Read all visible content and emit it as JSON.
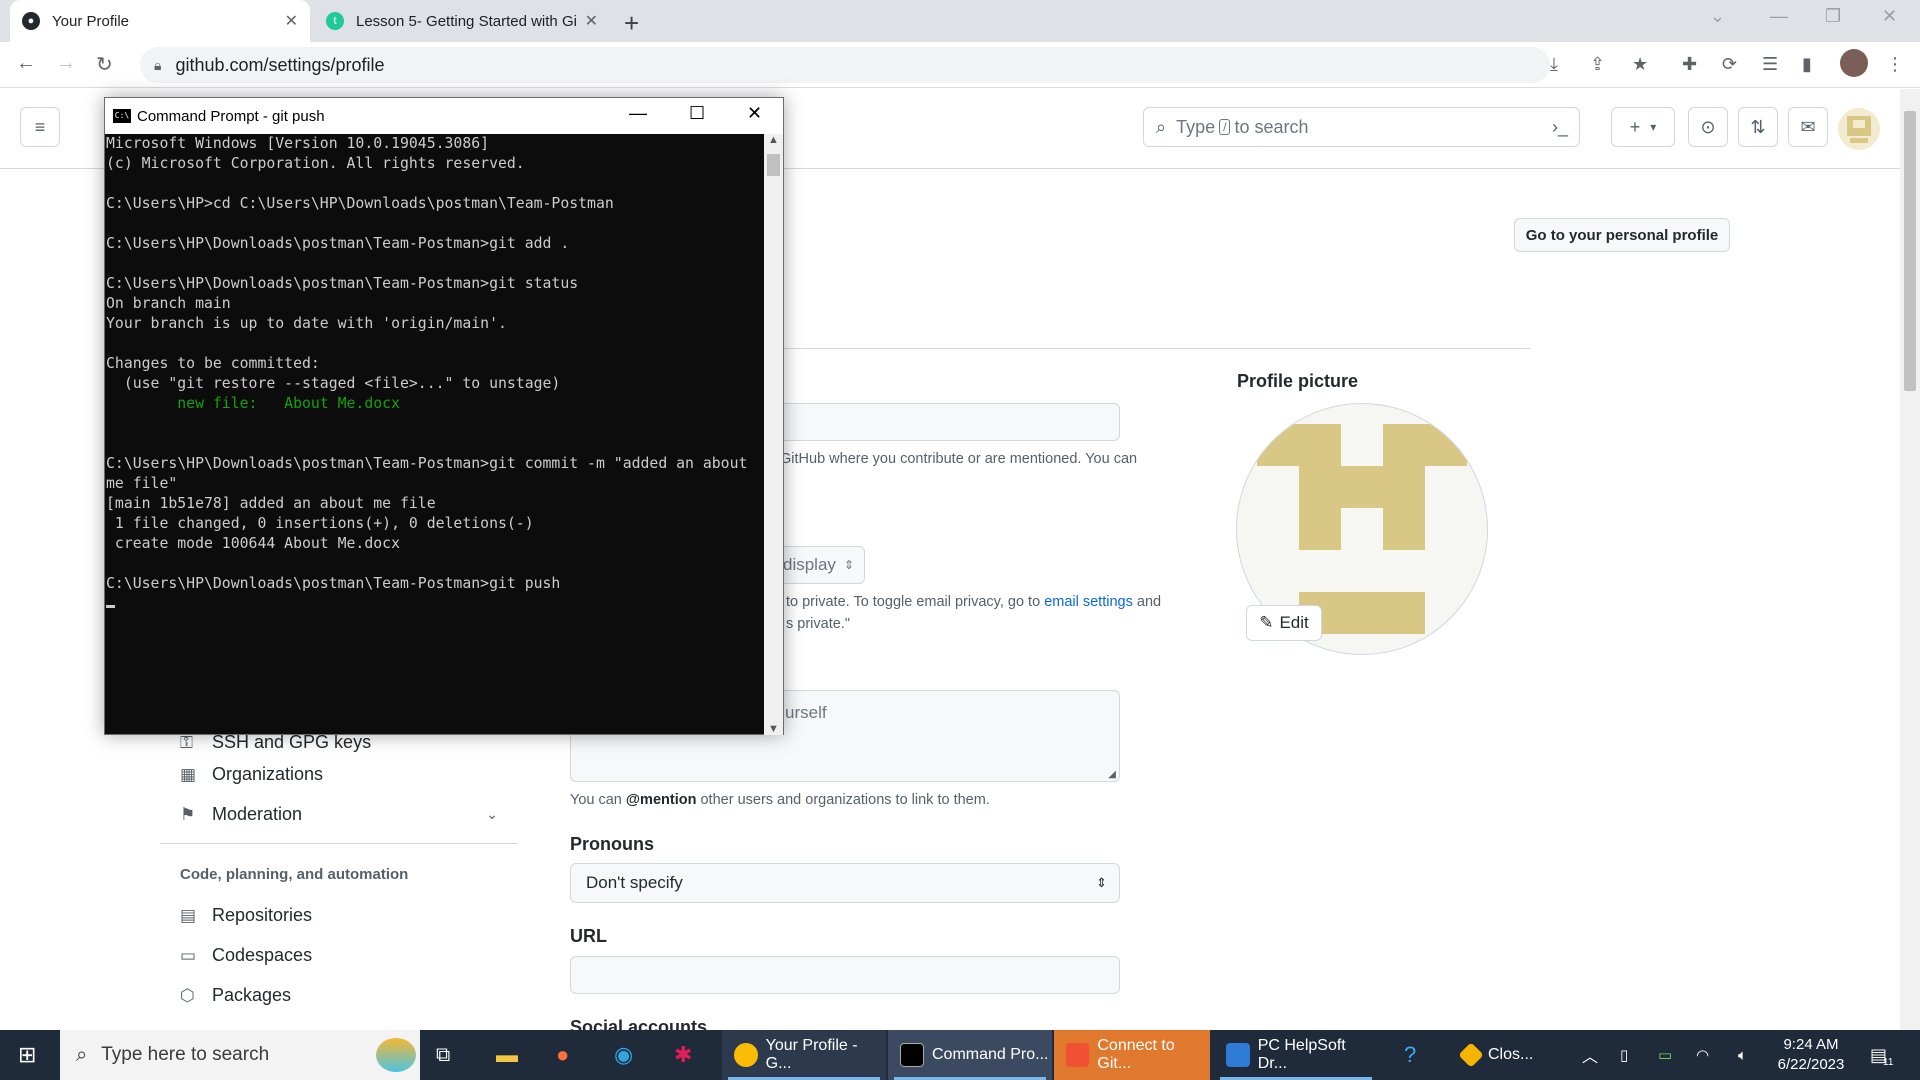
{
  "browser": {
    "tabs": [
      {
        "title": "Your Profile",
        "active": true
      },
      {
        "title": "Lesson 5- Getting Started with Gi",
        "active": false
      }
    ],
    "url": "github.com/settings/profile"
  },
  "github": {
    "search_prefix": "Type",
    "search_slash": "/",
    "search_suffix": "to search",
    "add_symbol": "+",
    "go_profile_button": "Go to your personal profile",
    "profile_picture_label": "Profile picture",
    "edit_label": "Edit",
    "name_note": "GitHub where you contribute or are mentioned. You can",
    "email_select_partial": "display",
    "email_note_1_pre": "to private. To toggle email privacy, go to",
    "email_note_link": "email settings",
    "email_note_1_post": "and",
    "email_note_2": "s private.\"",
    "bio_placeholder_partial": "urself",
    "bio_note_pre": "You can",
    "bio_note_mention": "@mention",
    "bio_note_post": "other users and organizations to link to them.",
    "pronouns_label": "Pronouns",
    "pronouns_value": "Don't specify",
    "url_label": "URL",
    "social_label": "Social accounts",
    "sidebar": {
      "partial_item": "SSH and GPG keys",
      "organizations": "Organizations",
      "moderation": "Moderation",
      "section_heading": "Code, planning, and automation",
      "repositories": "Repositories",
      "codespaces": "Codespaces",
      "packages": "Packages"
    }
  },
  "cmd": {
    "title": "Command Prompt - git  push",
    "lines": [
      "Microsoft Windows [Version 10.0.19045.3086]",
      "(c) Microsoft Corporation. All rights reserved.",
      "",
      "C:\\Users\\HP>cd C:\\Users\\HP\\Downloads\\postman\\Team-Postman",
      "",
      "C:\\Users\\HP\\Downloads\\postman\\Team-Postman>git add .",
      "",
      "C:\\Users\\HP\\Downloads\\postman\\Team-Postman>git status",
      "On branch main",
      "Your branch is up to date with 'origin/main'.",
      "",
      "Changes to be committed:",
      "  (use \"git restore --staged <file>...\" to unstage)"
    ],
    "staged_line": "        new file:   About Me.docx",
    "lines2": [
      "",
      "",
      "C:\\Users\\HP\\Downloads\\postman\\Team-Postman>git commit -m \"added an about",
      "me file\"",
      "[main 1b51e78] added an about me file",
      " 1 file changed, 0 insertions(+), 0 deletions(-)",
      " create mode 100644 About Me.docx",
      "",
      "C:\\Users\\HP\\Downloads\\postman\\Team-Postman>git push"
    ]
  },
  "taskbar": {
    "search_placeholder": "Type here to search",
    "apps": [
      {
        "label": "Your Profile - G..."
      },
      {
        "label": "Command Pro..."
      },
      {
        "label": "Connect to Git..."
      },
      {
        "label": "PC HelpSoft Dr..."
      },
      {
        "label": "Clos..."
      }
    ],
    "time": "9:24 AM",
    "date": "6/22/2023",
    "notification_count": "11"
  },
  "colors": {
    "github_link": "#0969da",
    "terminal_green": "#13a10e",
    "taskbar_bg": "#1f2a3a",
    "avatar_gold": "#d8c785"
  }
}
